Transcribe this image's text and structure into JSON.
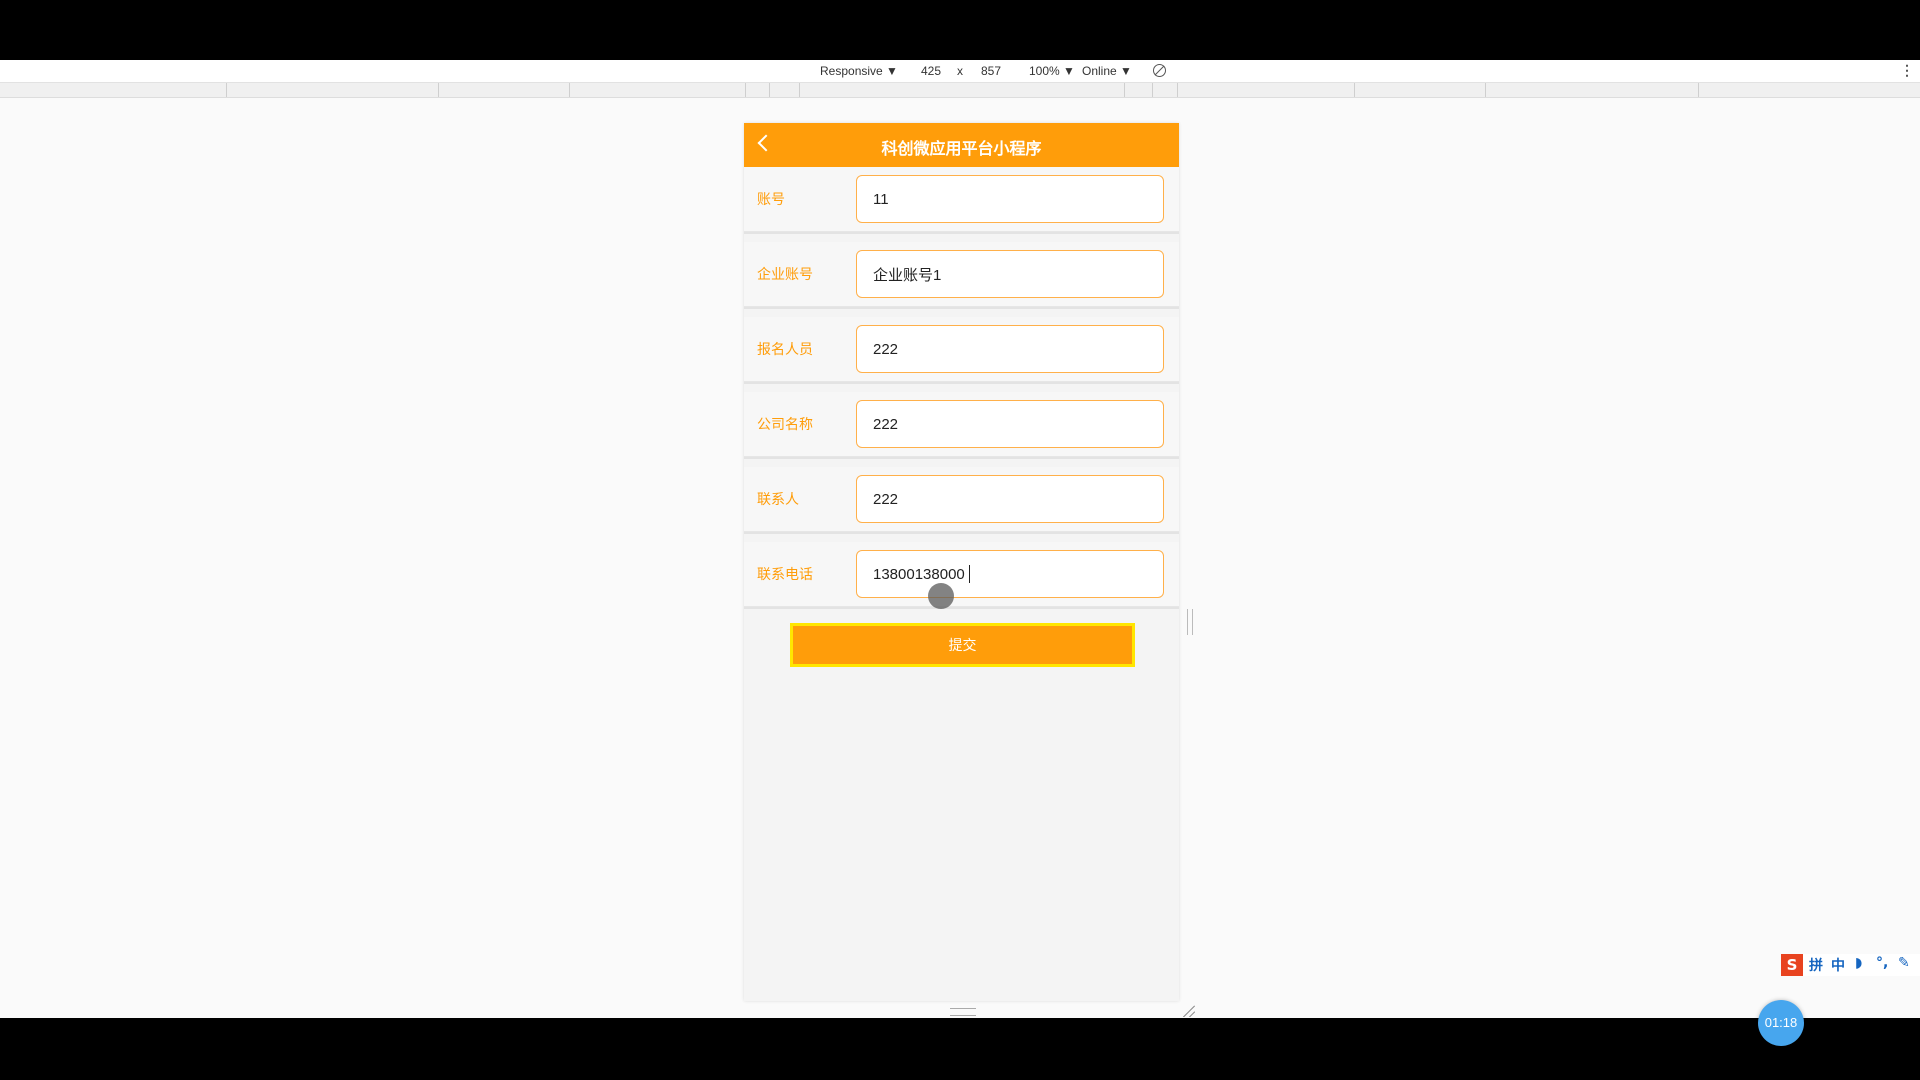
{
  "devtools": {
    "device_mode": "Responsive ▼",
    "width": "425",
    "times": "x",
    "height": "857",
    "zoom": "100% ▼",
    "network": "Online ▼",
    "more": "⋮"
  },
  "app": {
    "title": "科创微应用平台小程序",
    "fields": [
      {
        "label": "账号",
        "value": "11"
      },
      {
        "label": "企业账号",
        "value": "企业账号1"
      },
      {
        "label": "报名人员",
        "value": "222"
      },
      {
        "label": "公司名称",
        "value": "222"
      },
      {
        "label": "联系人",
        "value": "222"
      },
      {
        "label": "联系电话",
        "value": "13800138000"
      }
    ],
    "submit_label": "提交",
    "accent_color": "#ff9d0a"
  },
  "system": {
    "ime_logo": "S",
    "ime_items": [
      "拼",
      "中",
      "◗",
      "°,",
      "✎"
    ],
    "timer": "01:18"
  }
}
